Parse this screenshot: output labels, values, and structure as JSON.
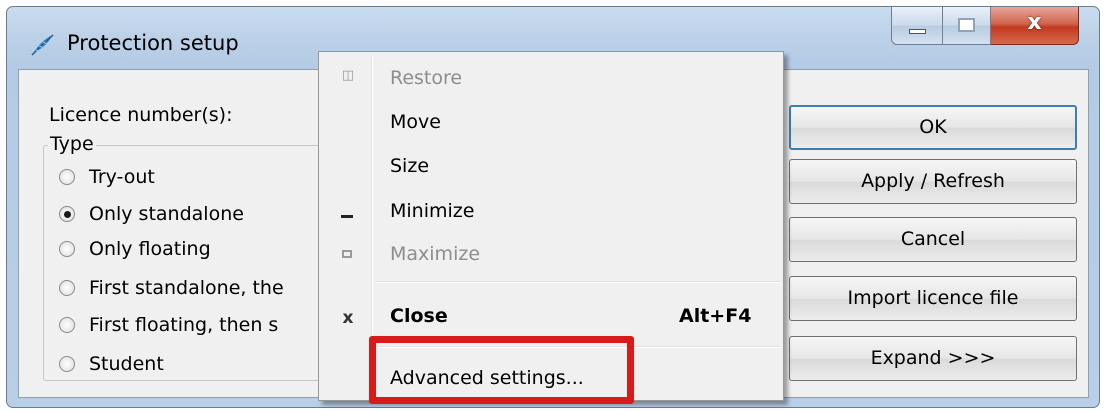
{
  "window": {
    "title": "Protection setup",
    "icon": "feather-app-icon"
  },
  "dialog": {
    "licence_label": "Licence number(s):",
    "type_group": {
      "legend": "Type",
      "options": [
        {
          "label": "Try-out",
          "checked": false
        },
        {
          "label": "Only standalone",
          "checked": true
        },
        {
          "label": "Only floating",
          "checked": false
        },
        {
          "label": "First standalone, the",
          "checked": false
        },
        {
          "label": "First floating, then s",
          "checked": false
        },
        {
          "label": "Student",
          "checked": false
        }
      ]
    },
    "buttons": {
      "ok": "OK",
      "apply": "Apply / Refresh",
      "cancel": "Cancel",
      "import": "Import licence file",
      "expand": "Expand >>>"
    }
  },
  "system_menu": {
    "items": [
      {
        "label": "Restore",
        "icon": "restore-icon",
        "glyph": "🗗",
        "disabled": true
      },
      {
        "label": "Move",
        "icon": "",
        "glyph": "",
        "disabled": false
      },
      {
        "label": "Size",
        "icon": "",
        "glyph": "",
        "disabled": false
      },
      {
        "label": "Minimize",
        "icon": "minimize-icon",
        "glyph": "_",
        "disabled": false
      },
      {
        "label": "Maximize",
        "icon": "maximize-icon",
        "glyph": "□",
        "disabled": true
      },
      {
        "label": "Close",
        "icon": "close-icon",
        "glyph": "x",
        "accelerator": "Alt+F4",
        "bold": true
      },
      {
        "label": "Advanced settings...",
        "icon": "",
        "glyph": ""
      }
    ]
  },
  "colors": {
    "highlight_box": "#d71a1a",
    "close_button": "#c1391f"
  }
}
